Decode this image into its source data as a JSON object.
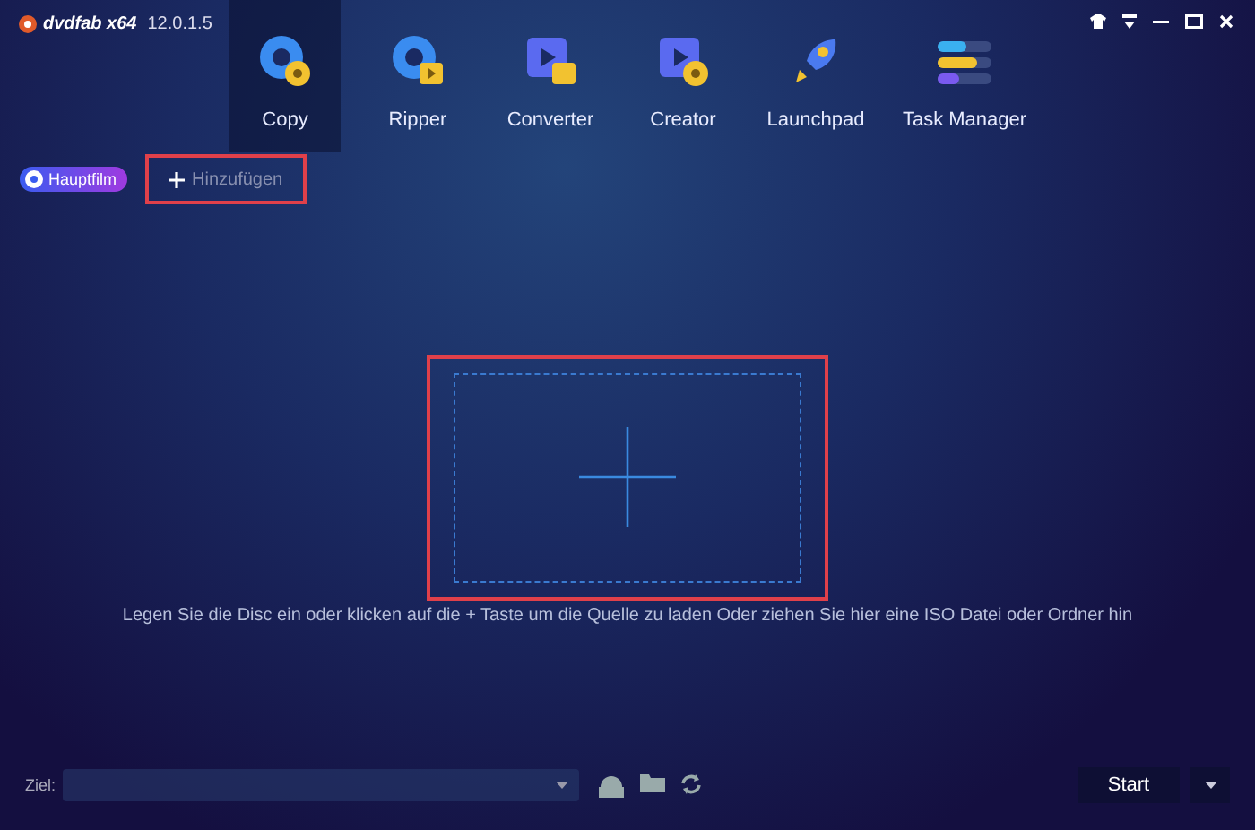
{
  "app": {
    "logo": "dvdfab x64",
    "version": "12.0.1.5"
  },
  "modules": [
    {
      "label": "Copy",
      "kind": "copy",
      "selected": true
    },
    {
      "label": "Ripper",
      "kind": "ripper",
      "selected": false
    },
    {
      "label": "Converter",
      "kind": "converter",
      "selected": false
    },
    {
      "label": "Creator",
      "kind": "creator",
      "selected": false
    },
    {
      "label": "Launchpad",
      "kind": "launchpad",
      "selected": false
    },
    {
      "label": "Task Manager",
      "kind": "tasks",
      "selected": false
    }
  ],
  "toolbar": {
    "main_movie": "Hauptfilm",
    "add": {
      "label": "Hinzufügen",
      "highlighted": true
    }
  },
  "drop_zone": {
    "highlighted": true,
    "hint": "Legen Sie die Disc ein oder klicken auf die + Taste um die Quelle zu laden Oder ziehen Sie hier eine ISO Datei oder Ordner hin"
  },
  "bottom": {
    "target_label": "Ziel:",
    "start": "Start"
  }
}
